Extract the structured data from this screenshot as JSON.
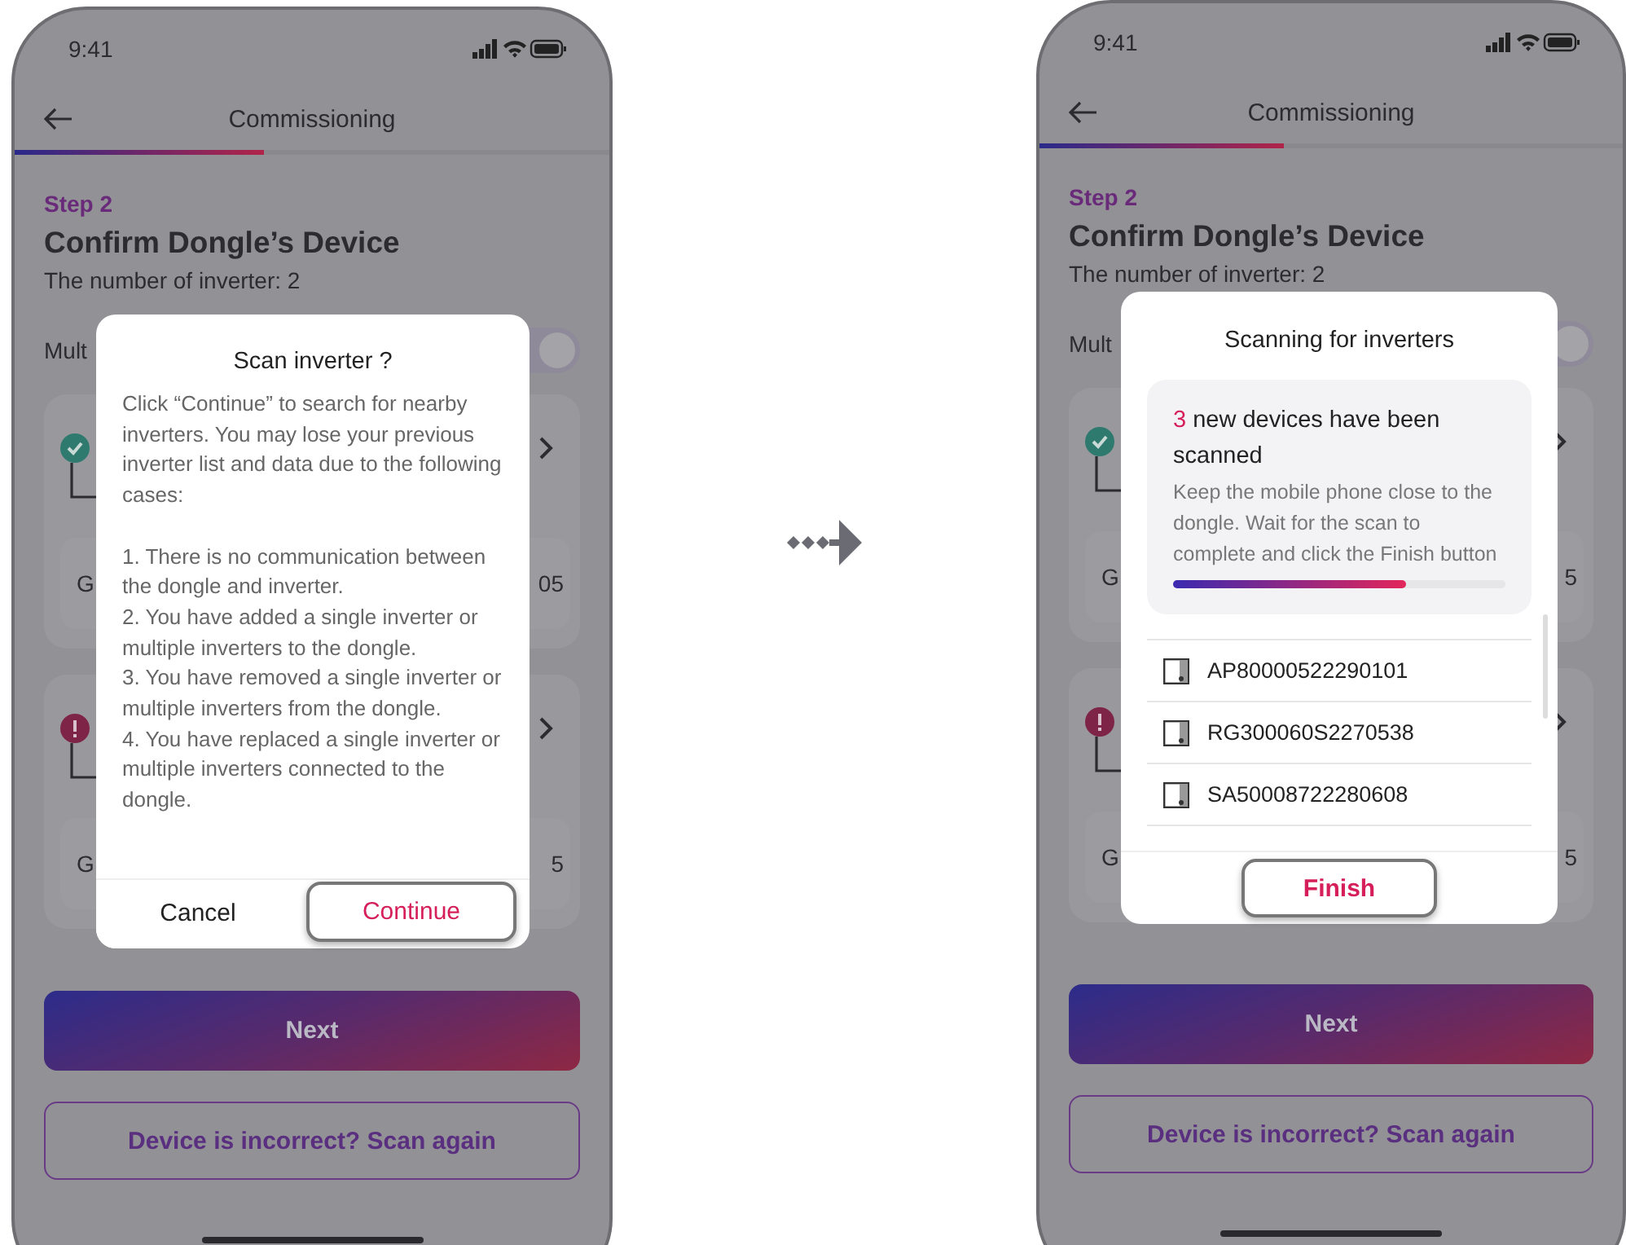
{
  "screens": [
    {
      "status_bar": {
        "time": "9:41"
      },
      "nav": {
        "title": "Commissioning"
      },
      "step_progress": {
        "level": 0.42
      },
      "step": "Step 2",
      "heading": "Confirm Dongle’s Device",
      "subheading": "The number of inverter: 2",
      "multi_label": "Mult",
      "multi_toggle": {
        "on": true
      },
      "cards": [
        {
          "kind": "ok",
          "left_text": "G",
          "right_text": "05"
        },
        {
          "kind": "error",
          "left_text": "G",
          "right_text": "5"
        }
      ],
      "next_button": "Next",
      "rescan_button": "Device is incorrect? Scan again",
      "dialog": {
        "kind": "confirm",
        "title": "Scan inverter ?",
        "intro": "Click “Continue” to search for nearby inverters. You may lose your previous inverter list and data due to the following cases:",
        "cases": [
          "1. There is no communication between the dongle and inverter.",
          "2. You have added a single inverter or multiple inverters to the dongle.",
          "3. You have removed a single inverter or multiple inverters from the dongle.",
          "4. You have replaced a single inverter or multiple inverters connected to the dongle."
        ],
        "buttons": [
          {
            "label": "Cancel",
            "focused": false
          },
          {
            "label": "Continue",
            "focused": true
          }
        ]
      }
    },
    {
      "status_bar": {
        "time": "9:41"
      },
      "nav": {
        "title": "Commissioning"
      },
      "step_progress": {
        "level": 0.42
      },
      "step": "Step 2",
      "heading": "Confirm Dongle’s Device",
      "subheading": "The number of inverter: 2",
      "multi_label": "Mult",
      "multi_toggle": {
        "on": true
      },
      "cards": [
        {
          "kind": "ok",
          "left_text": "G",
          "right_text": "5"
        },
        {
          "kind": "error",
          "left_text": "G",
          "right_text": "5"
        }
      ],
      "next_button": "Next",
      "rescan_button": "Device is incorrect? Scan again",
      "dialog": {
        "kind": "scan",
        "title": "Scanning for inverters",
        "count": "3",
        "summary": "new devices have been scanned",
        "description": "Keep the mobile phone close to the dongle. Wait for the scan to complete and click the Finish button",
        "progress": {
          "level": 0.7
        },
        "devices": [
          "AP80000522290101",
          "RG300060S2270538",
          "SA50008722280608"
        ],
        "buttons": [
          {
            "label": "Finish",
            "focused": true
          }
        ]
      }
    }
  ]
}
